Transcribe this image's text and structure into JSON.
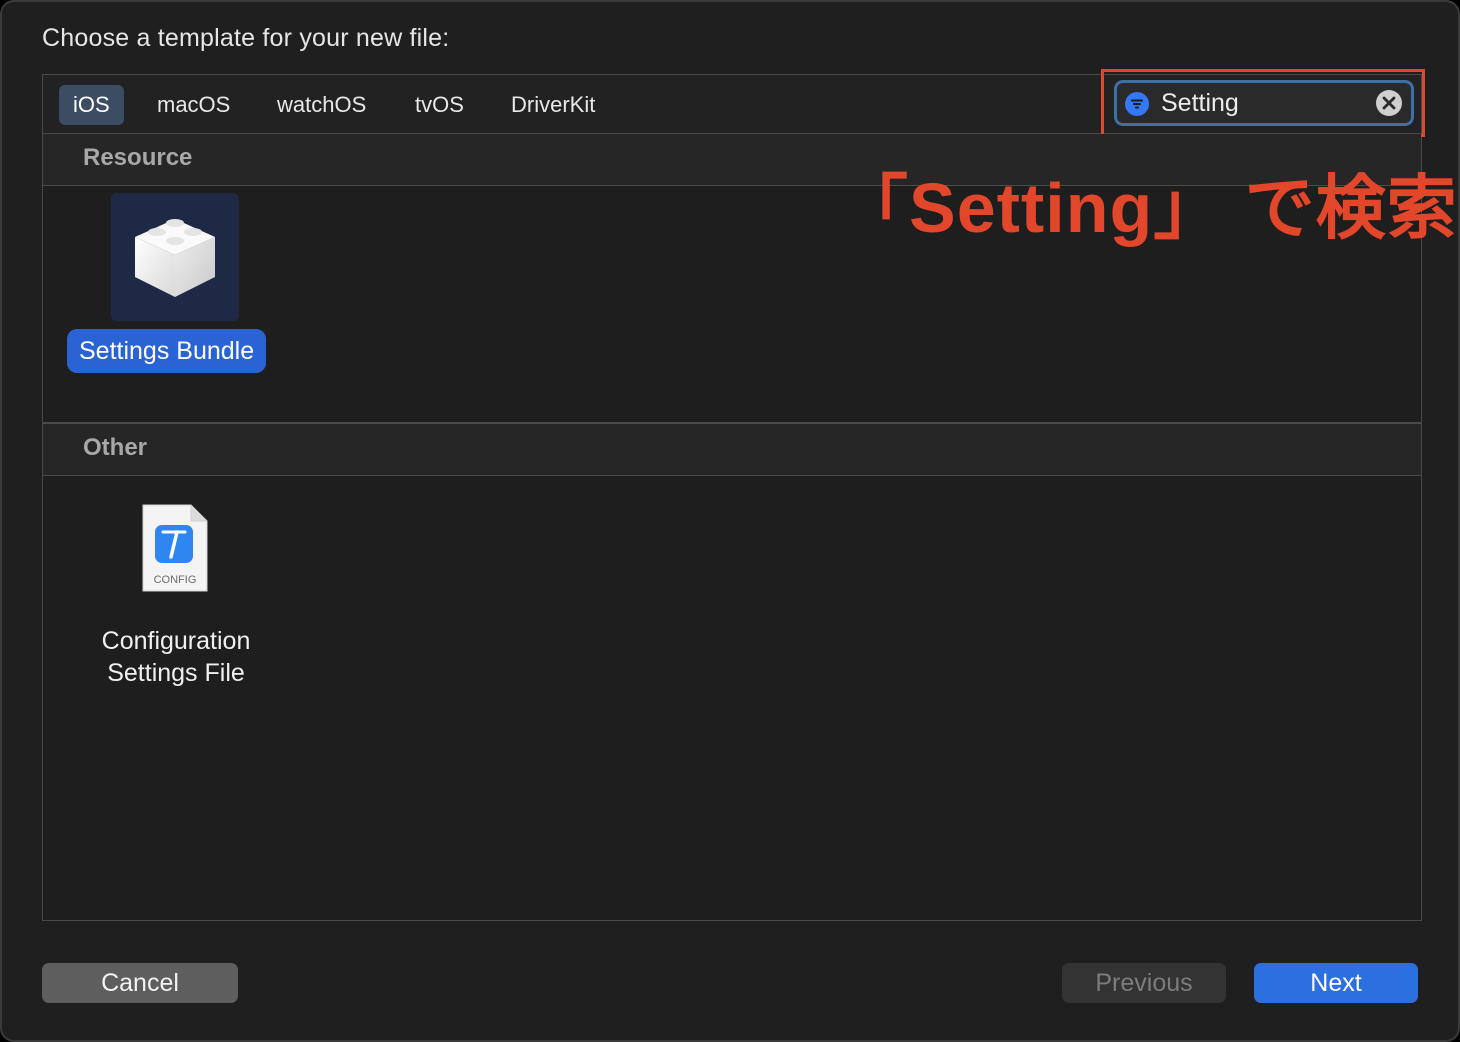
{
  "dialog": {
    "title": "Choose a template for your new file:"
  },
  "tabs": [
    {
      "label": "iOS",
      "active": true
    },
    {
      "label": "macOS",
      "active": false
    },
    {
      "label": "watchOS",
      "active": false
    },
    {
      "label": "tvOS",
      "active": false
    },
    {
      "label": "DriverKit",
      "active": false
    }
  ],
  "search": {
    "value": "Setting",
    "filter_icon": "filter-icon",
    "clear_icon": "clear-icon"
  },
  "annotation": {
    "text": "「Setting」 で検索",
    "color": "#e2462b"
  },
  "sections": [
    {
      "header": "Resource",
      "templates": [
        {
          "label": "Settings Bundle",
          "icon": "lego-brick-icon",
          "selected": true
        }
      ]
    },
    {
      "header": "Other",
      "templates": [
        {
          "label_line1": "Configuration",
          "label_line2": "Settings File",
          "icon": "config-file-icon",
          "icon_caption": "CONFIG",
          "selected": false
        }
      ]
    }
  ],
  "buttons": {
    "cancel": "Cancel",
    "previous": "Previous",
    "next": "Next"
  },
  "colors": {
    "accent": "#2c6fdf",
    "selected_tab": "#3b4c63",
    "annotation_red": "#e2462b"
  }
}
